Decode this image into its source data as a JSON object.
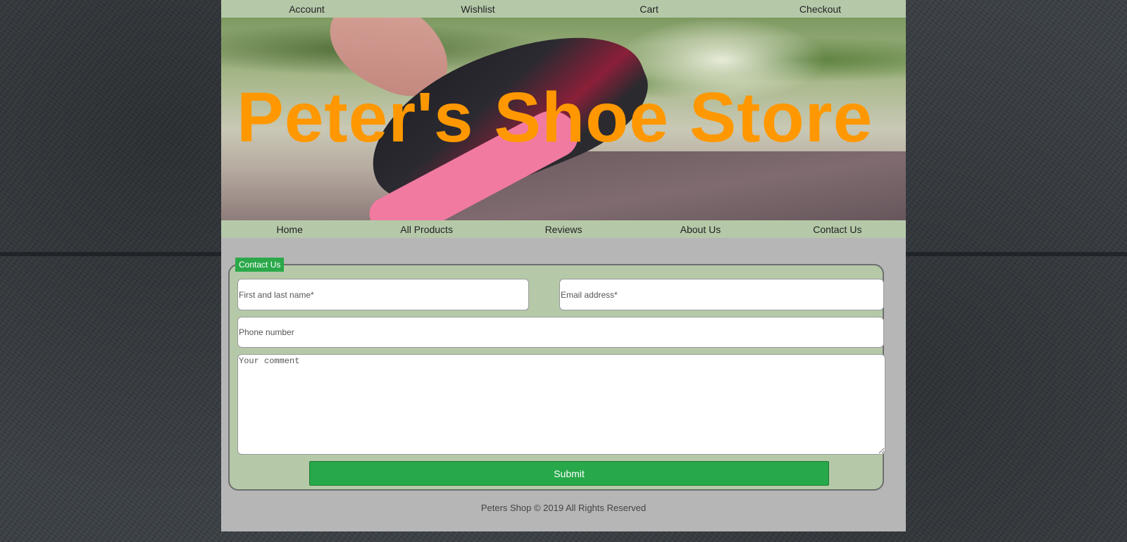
{
  "top_nav": {
    "items": [
      "Account",
      "Wishlist",
      "Cart",
      "Checkout"
    ]
  },
  "hero": {
    "title": "Peter's Shoe Store"
  },
  "main_nav": {
    "items": [
      "Home",
      "All Products",
      "Reviews",
      "About Us",
      "Contact Us"
    ]
  },
  "contact_form": {
    "legend": "Contact Us",
    "name_placeholder": "First and last name*",
    "email_placeholder": "Email address*",
    "phone_placeholder": "Phone number",
    "comment_placeholder": "Your comment",
    "submit_label": "Submit"
  },
  "footer": {
    "text": "Peters Shop © 2019 All Rights Reserved"
  },
  "colors": {
    "nav_background": "#b5c9a9",
    "page_background": "#b6b6b6",
    "title_orange": "#ff9800",
    "button_green": "#27a84a"
  }
}
